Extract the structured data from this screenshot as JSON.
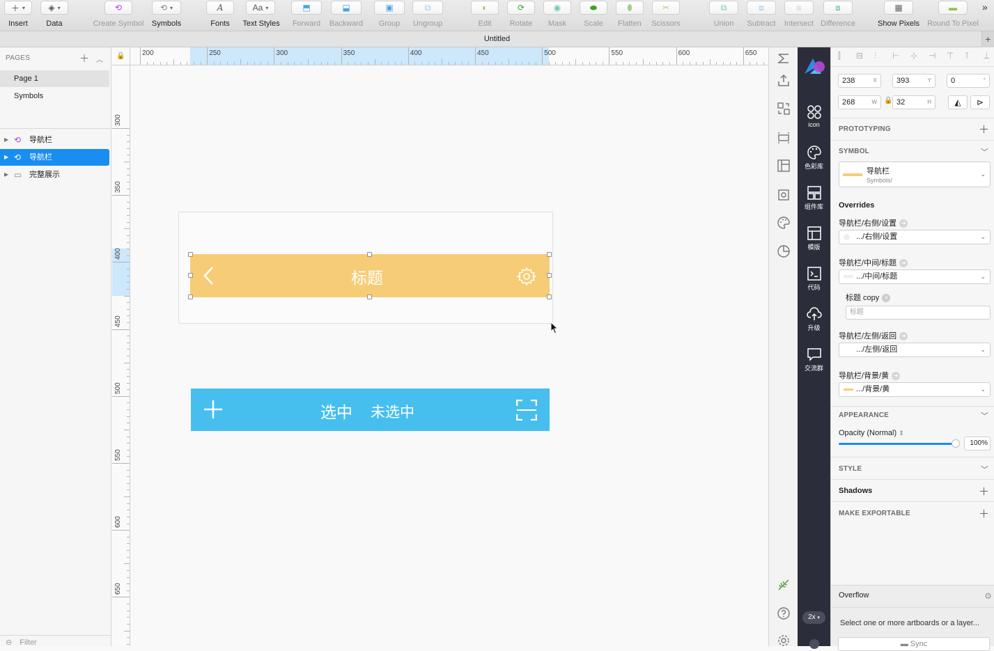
{
  "toolbar": {
    "items": [
      {
        "label": "Insert",
        "icon": "plus-icon",
        "dim": false
      },
      {
        "label": "Data",
        "icon": "layers-icon",
        "dim": false
      },
      {
        "label": "Create Symbol",
        "icon": "symbol-icon",
        "dim": true
      },
      {
        "label": "Symbols",
        "icon": "symbol-icon",
        "dim": false
      },
      {
        "label": "Fonts",
        "icon": "font-icon",
        "dim": false
      },
      {
        "label": "Text Styles",
        "icon": "text-style-icon",
        "dim": false
      },
      {
        "label": "Forward",
        "icon": "forward-icon",
        "dim": true
      },
      {
        "label": "Backward",
        "icon": "backward-icon",
        "dim": true
      },
      {
        "label": "Group",
        "icon": "group-icon",
        "dim": true
      },
      {
        "label": "Ungroup",
        "icon": "ungroup-icon",
        "dim": true
      },
      {
        "label": "Edit",
        "icon": "edit-icon",
        "dim": true
      },
      {
        "label": "Rotate",
        "icon": "rotate-icon",
        "dim": true
      },
      {
        "label": "Mask",
        "icon": "mask-icon",
        "dim": true
      },
      {
        "label": "Scale",
        "icon": "scale-icon",
        "dim": true
      },
      {
        "label": "Flatten",
        "icon": "flatten-icon",
        "dim": true
      },
      {
        "label": "Scissors",
        "icon": "scissors-icon",
        "dim": true
      },
      {
        "label": "Union",
        "icon": "union-icon",
        "dim": true
      },
      {
        "label": "Subtract",
        "icon": "subtract-icon",
        "dim": true
      },
      {
        "label": "Intersect",
        "icon": "intersect-icon",
        "dim": true
      },
      {
        "label": "Difference",
        "icon": "difference-icon",
        "dim": true
      },
      {
        "label": "Show Pixels",
        "icon": "pixels-icon",
        "dim": false
      },
      {
        "label": "Round To Pixel",
        "icon": "round-pixel-icon",
        "dim": true
      }
    ],
    "text_styles_glyph": "Aa",
    "fonts_glyph": "A",
    "more": "»"
  },
  "window": {
    "title": "Untitled",
    "new_tab": "+"
  },
  "pages_panel": {
    "header": "PAGES",
    "pages": [
      "Page 1",
      "Symbols"
    ],
    "layers": [
      {
        "name": "导航栏",
        "type": "symbol",
        "selected": false
      },
      {
        "name": "导航栏",
        "type": "symbol",
        "selected": true
      },
      {
        "name": "完整展示",
        "type": "folder",
        "selected": false
      }
    ],
    "filter_placeholder": "Filter"
  },
  "rulers": {
    "top": [
      "200",
      "250",
      "300",
      "350",
      "400",
      "450",
      "500",
      "550",
      "600",
      "650"
    ],
    "left": [
      "300",
      "350",
      "400",
      "450",
      "500",
      "550",
      "600",
      "650"
    ]
  },
  "canvas": {
    "yellow_bar_title": "标题",
    "blue_bar_selected": "选中",
    "blue_bar_unselected": "未选中"
  },
  "plugin_bar": {
    "items": [
      "icon",
      "色彩库",
      "组件库",
      "模版",
      "代码",
      "升级",
      "交流群"
    ],
    "zoom": "2x"
  },
  "inspector": {
    "x": "238",
    "x_unit": "X",
    "y": "393",
    "y_unit": "Y",
    "rotation": "0",
    "rotation_unit": "°",
    "w": "268",
    "w_unit": "W",
    "h": "32",
    "h_unit": "H",
    "prototyping": "PROTOTYPING",
    "symbol_section": "SYMBOL",
    "symbol_name": "导航栏",
    "symbol_path": "Symbols/",
    "overrides_title": "Overrides",
    "overrides": [
      {
        "label": "导航栏/右侧/设置",
        "value": ".../右侧/设置"
      },
      {
        "label": "导航栏/中间/标题",
        "value": ".../中间/标题"
      },
      {
        "label": "导航栏/左侧/返回",
        "value": ".../左侧/返回"
      },
      {
        "label": "导航栏/背景/黄",
        "value": ".../背景/黄"
      }
    ],
    "title_copy_label": "标题 copy",
    "title_copy_placeholder": "标题",
    "appearance": "APPEARANCE",
    "opacity_label": "Opacity (Normal)",
    "opacity_value": "100%",
    "opacity_level": 1.0,
    "style": "STYLE",
    "shadows": "Shadows",
    "make_exportable": "MAKE EXPORTABLE",
    "overflow": "Overflow",
    "overflow_hint": "Select one or more artboards or a layer...",
    "sync": "Sync"
  },
  "colors": {
    "accent": "#1a8df1",
    "nav_yellow": "#f6cd76",
    "nav_blue": "#47bfee",
    "plugin_bar": "#2b2e3a"
  }
}
